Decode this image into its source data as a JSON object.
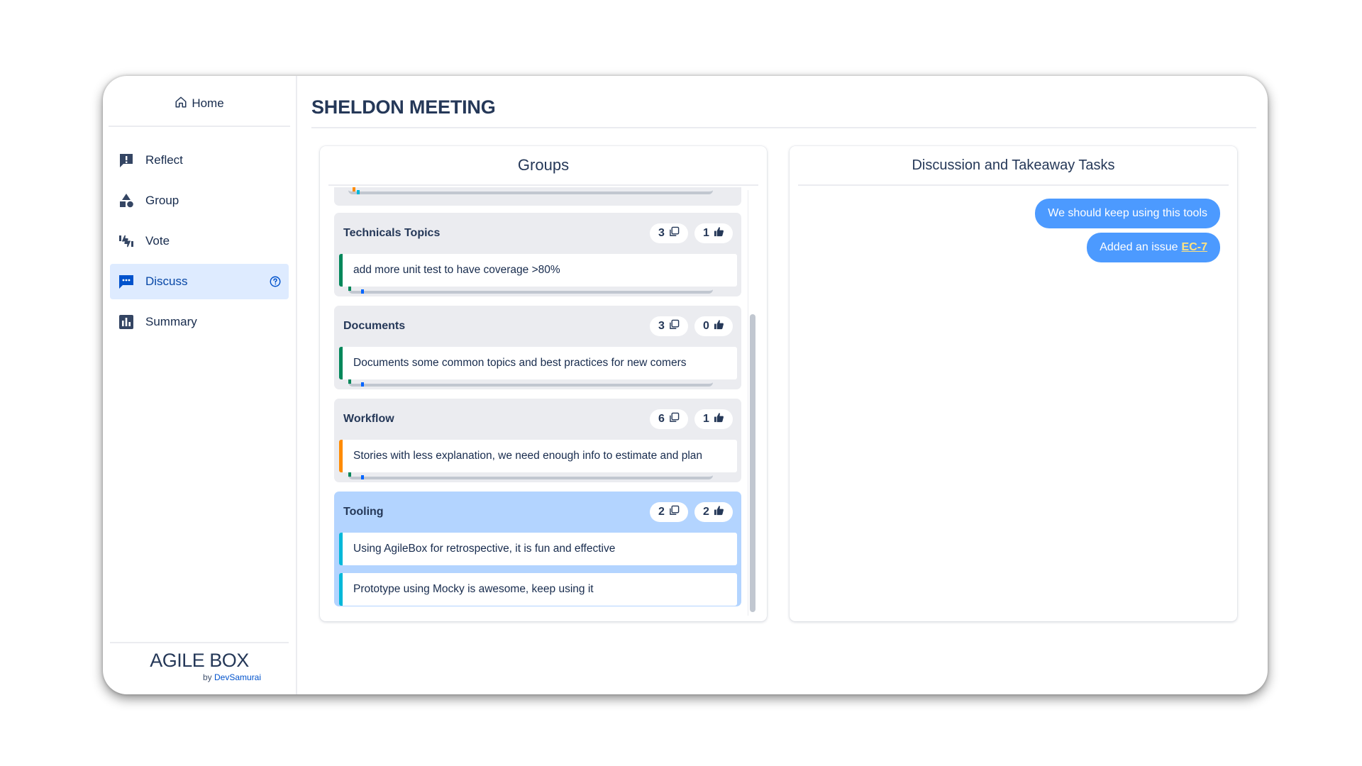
{
  "sidebar": {
    "home_label": "Home",
    "items": [
      {
        "label": "Reflect",
        "icon": "reflect-icon"
      },
      {
        "label": "Group",
        "icon": "group-icon"
      },
      {
        "label": "Vote",
        "icon": "vote-icon"
      },
      {
        "label": "Discuss",
        "icon": "discuss-icon",
        "active": true
      },
      {
        "label": "Summary",
        "icon": "summary-icon"
      }
    ],
    "brand": {
      "title": "AGILE BOX",
      "by": "by",
      "company": "DevSamurai"
    }
  },
  "page": {
    "title": "SHELDON MEETING"
  },
  "groups_panel": {
    "title": "Groups",
    "groups": [
      {
        "name": "Technicals Topics",
        "card_count": "3",
        "vote_count": "1",
        "cards": [
          "add more unit test to have coverage >80%"
        ]
      },
      {
        "name": "Documents",
        "card_count": "3",
        "vote_count": "0",
        "cards": [
          "Documents some common topics and best practices for new comers"
        ]
      },
      {
        "name": "Workflow",
        "card_count": "6",
        "vote_count": "1",
        "cards": [
          "Stories with less explanation, we need enough info to estimate and plan"
        ]
      },
      {
        "name": "Tooling",
        "card_count": "2",
        "vote_count": "2",
        "cards": [
          "Using AgileBox for retrospective, it is fun and effective",
          "Prototype using Mocky is awesome, keep using it"
        ]
      }
    ]
  },
  "discussion_panel": {
    "title": "Discussion and Takeaway Tasks",
    "messages": [
      {
        "text": "We should keep using this tools"
      },
      {
        "text": "Added an issue",
        "link": "EC-7"
      }
    ]
  },
  "colors": {
    "active_nav_bg": "#deebff",
    "highlight_group_bg": "#b3d4ff",
    "bubble_bg": "#4c9aff",
    "link_color": "#ffe380",
    "card_green": "#00875a",
    "card_orange": "#ff8b00",
    "card_cyan": "#00b8d9"
  }
}
